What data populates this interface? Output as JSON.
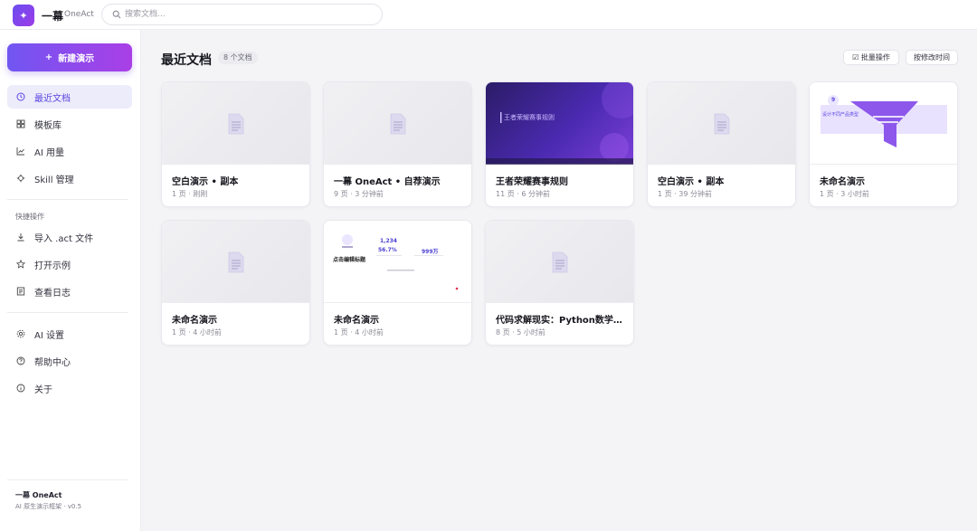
{
  "app": {
    "name": "一幕",
    "subtitle": "OneAct"
  },
  "search": {
    "placeholder": "搜索文档..."
  },
  "sidebar": {
    "new_button": "新建演示",
    "nav": [
      {
        "label": "最近文档",
        "icon": "clock-icon",
        "active": true
      },
      {
        "label": "模板库",
        "icon": "grid-icon"
      },
      {
        "label": "AI 用量",
        "icon": "chart-icon"
      },
      {
        "label": "Skill 管理",
        "icon": "plug-icon"
      }
    ],
    "quick_title": "快捷操作",
    "quick": [
      {
        "label": "导入 .act 文件",
        "icon": "download-icon"
      },
      {
        "label": "打开示例",
        "icon": "star-icon"
      },
      {
        "label": "查看日志",
        "icon": "log-icon"
      }
    ],
    "bottom": [
      {
        "label": "AI 设置",
        "icon": "gear-icon"
      },
      {
        "label": "帮助中心",
        "icon": "help-icon"
      },
      {
        "label": "关于",
        "icon": "info-icon"
      }
    ],
    "footer_name": "一幕 OneAct",
    "footer_version": "AI 原生演示框架 · v0.5"
  },
  "main": {
    "title": "最近文档",
    "count": "8 个文档",
    "batch_label": "☑ 批量操作",
    "sort_label": "按修改时间"
  },
  "cards": [
    {
      "title": "空白演示 • 副本",
      "meta": "1 页 · 刚刚",
      "thumb": "blank"
    },
    {
      "title": "一幕 OneAct • 自荐演示",
      "meta": "9 页 · 3 分钟前",
      "thumb": "blank"
    },
    {
      "title": "王者荣耀赛事规则",
      "meta": "11 页 · 6 分钟前",
      "thumb": "purple"
    },
    {
      "title": "空白演示 • 副本",
      "meta": "1 页 · 39 分钟前",
      "thumb": "blank"
    },
    {
      "title": "未命名演示",
      "meta": "1 页 · 3 小时前",
      "thumb": "funnel"
    },
    {
      "title": "未命名演示",
      "meta": "1 页 · 4 小时前",
      "thumb": "blank"
    },
    {
      "title": "未命名演示",
      "meta": "1 页 · 4 小时前",
      "thumb": "stats"
    },
    {
      "title": "代码求解现实：Python数学建模…",
      "meta": "8 页 · 5 小时前",
      "thumb": "blank"
    }
  ],
  "thumb_text": {
    "purple_heading": "王者荣耀赛事规则",
    "funnel_number": "9",
    "funnel_line": "设计不同产品类型",
    "stats_edit": "点击编辑标题",
    "stats_num1": "1,234",
    "stats_num2": "56.7%",
    "stats_num3": "999万"
  },
  "colors": {
    "accent": "#6a4df0",
    "accent2": "#a93fe6"
  }
}
